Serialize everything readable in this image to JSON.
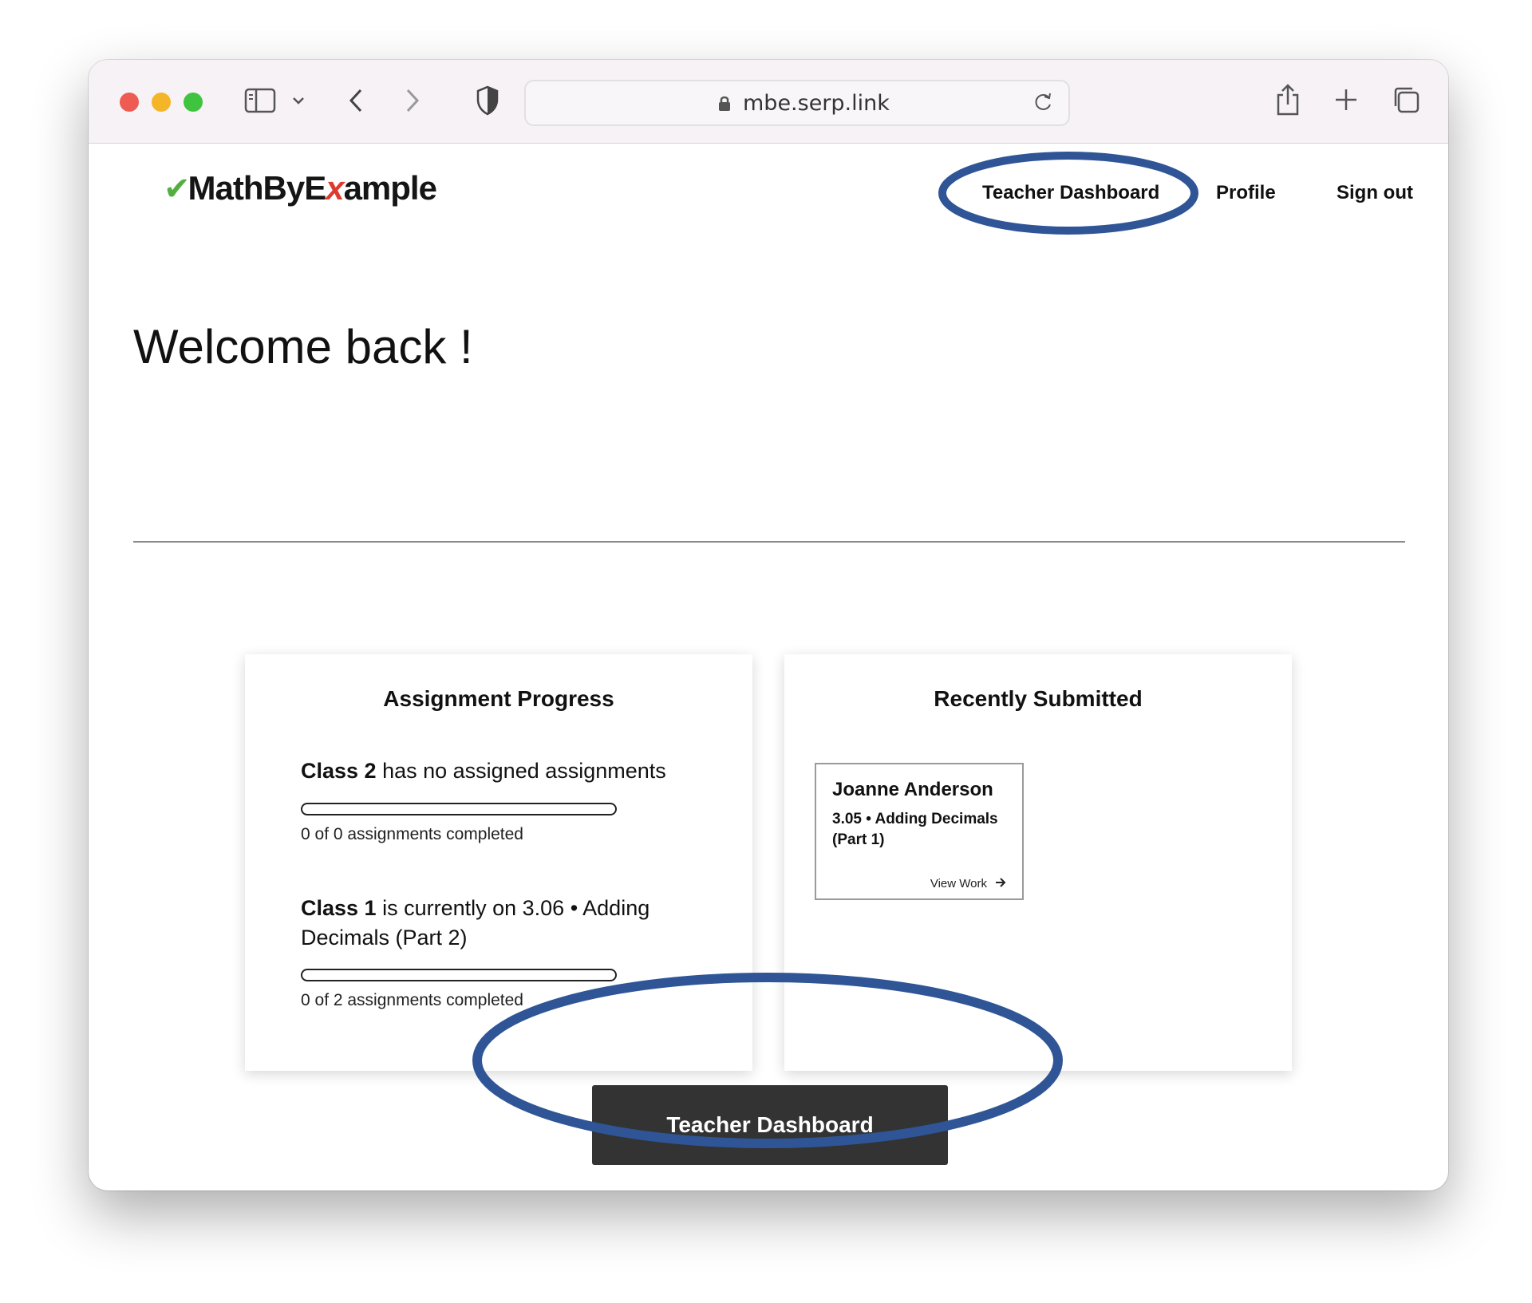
{
  "browser": {
    "url": "mbe.serp.link"
  },
  "header": {
    "logo": {
      "part1": "MathByE",
      "part2": "x",
      "part3": "ample"
    },
    "nav": [
      {
        "label": "Teacher Dashboard"
      },
      {
        "label": "Profile"
      },
      {
        "label": "Sign out"
      }
    ]
  },
  "main": {
    "welcome": "Welcome back !",
    "progress_card": {
      "title": "Assignment Progress",
      "classes": [
        {
          "name": "Class 2",
          "status": " has no assigned assignments",
          "progress": 0,
          "completed_text": "0 of 0 assignments completed"
        },
        {
          "name": "Class 1",
          "status": " is currently on 3.06 • Adding Decimals (Part 2)",
          "progress": 0,
          "completed_text": "0 of 2 assignments completed"
        }
      ]
    },
    "recent_card": {
      "title": "Recently Submitted",
      "submissions": [
        {
          "student": "Joanne Anderson",
          "lesson": "3.05 • Adding Decimals (Part 1)",
          "link": "View Work"
        }
      ]
    },
    "dashboard_button": "Teacher Dashboard"
  },
  "colors": {
    "annotation": "#2f5597",
    "button_bg": "#333333",
    "logo_check": "#53b040",
    "logo_x": "#dd3b30"
  }
}
